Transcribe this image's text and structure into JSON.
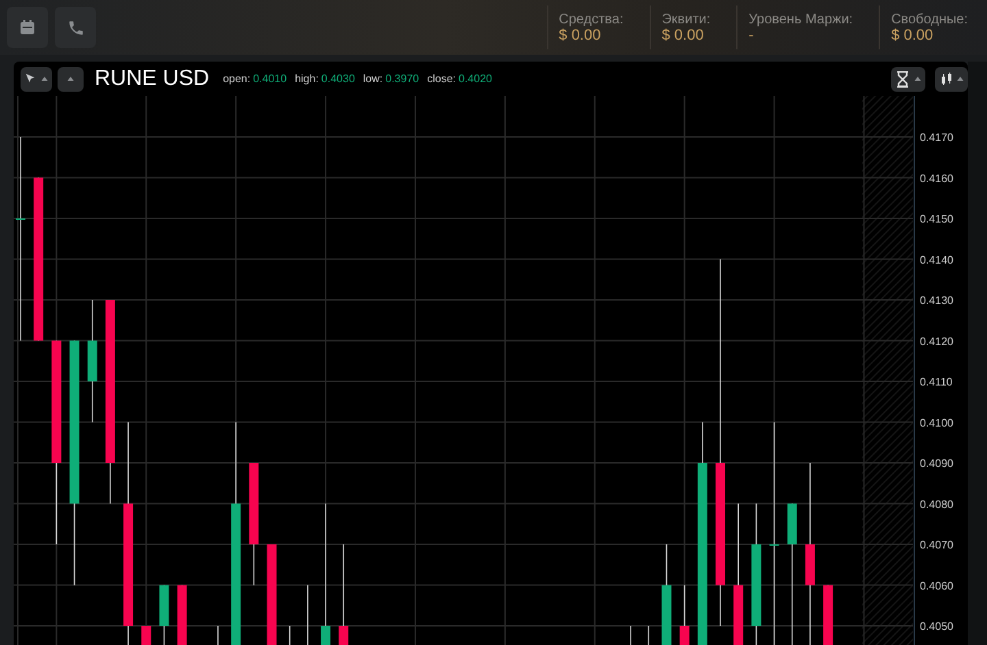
{
  "account": [
    {
      "label": "Средства:",
      "value": "$ 0.00"
    },
    {
      "label": "Эквити:",
      "value": "$ 0.00"
    },
    {
      "label": "Уровень Маржи:",
      "value": "-"
    },
    {
      "label": "Свободные:",
      "value": "$ 0.00"
    }
  ],
  "chart_panel": {
    "symbol": "RUNE USD",
    "ohlc": [
      {
        "label": "open:",
        "value": "0.4010"
      },
      {
        "label": "high:",
        "value": "0.4030"
      },
      {
        "label": "low:",
        "value": "0.3970"
      },
      {
        "label": "close:",
        "value": "0.4020"
      }
    ],
    "price_axis_labels": [
      "0.4170",
      "0.4160",
      "0.4150",
      "0.4140",
      "0.4130",
      "0.4120",
      "0.4110",
      "0.4100",
      "0.4090",
      "0.4080",
      "0.4070",
      "0.4060",
      "0.4050"
    ]
  }
}
